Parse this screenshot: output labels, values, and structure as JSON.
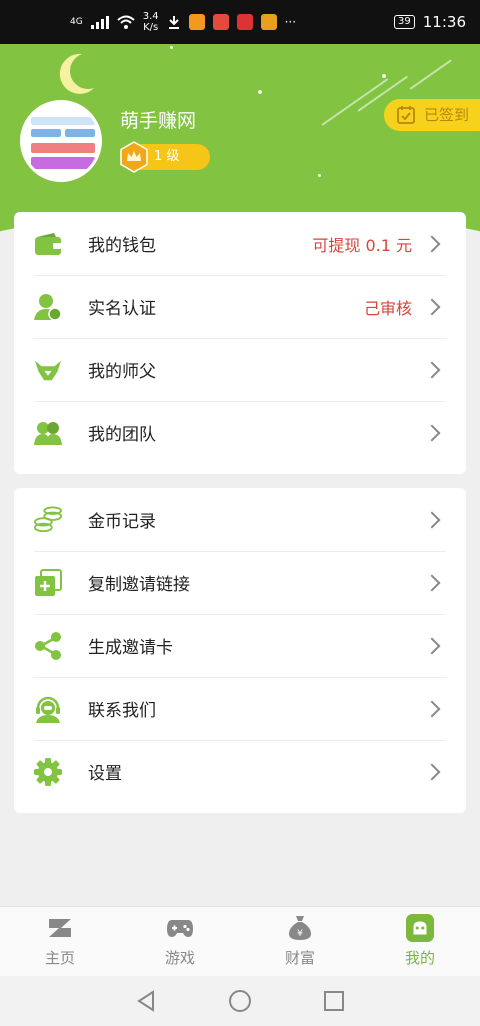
{
  "status_bar": {
    "network": "4G",
    "speed": "3.4",
    "speed_unit": "K/s",
    "battery": "39",
    "time": "11:36"
  },
  "profile": {
    "username": "萌手赚网",
    "level": "1 级",
    "signin_label": "已签到"
  },
  "menu_group_1": [
    {
      "icon": "wallet-icon",
      "label": "我的钱包",
      "value": "可提现 0.1 元"
    },
    {
      "icon": "verified-user-icon",
      "label": "实名认证",
      "value": "己审核"
    },
    {
      "icon": "master-icon",
      "label": "我的师父",
      "value": ""
    },
    {
      "icon": "team-icon",
      "label": "我的团队",
      "value": ""
    }
  ],
  "menu_group_2": [
    {
      "icon": "coins-icon",
      "label": "金币记录"
    },
    {
      "icon": "copy-link-icon",
      "label": "复制邀请链接"
    },
    {
      "icon": "share-icon",
      "label": "生成邀请卡"
    },
    {
      "icon": "customer-service-icon",
      "label": "联系我们"
    },
    {
      "icon": "gear-icon",
      "label": "设置"
    }
  ],
  "tabs": [
    {
      "icon": "home-icon",
      "label": "主页",
      "active": false
    },
    {
      "icon": "gamepad-icon",
      "label": "游戏",
      "active": false
    },
    {
      "icon": "money-bag-icon",
      "label": "财富",
      "active": false
    },
    {
      "icon": "profile-icon",
      "label": "我的",
      "active": true
    }
  ],
  "colors": {
    "brand_green": "#82c342",
    "accent_yellow": "#f7d21c",
    "value_red": "#d9453a",
    "active_tab": "#7bb83c"
  }
}
